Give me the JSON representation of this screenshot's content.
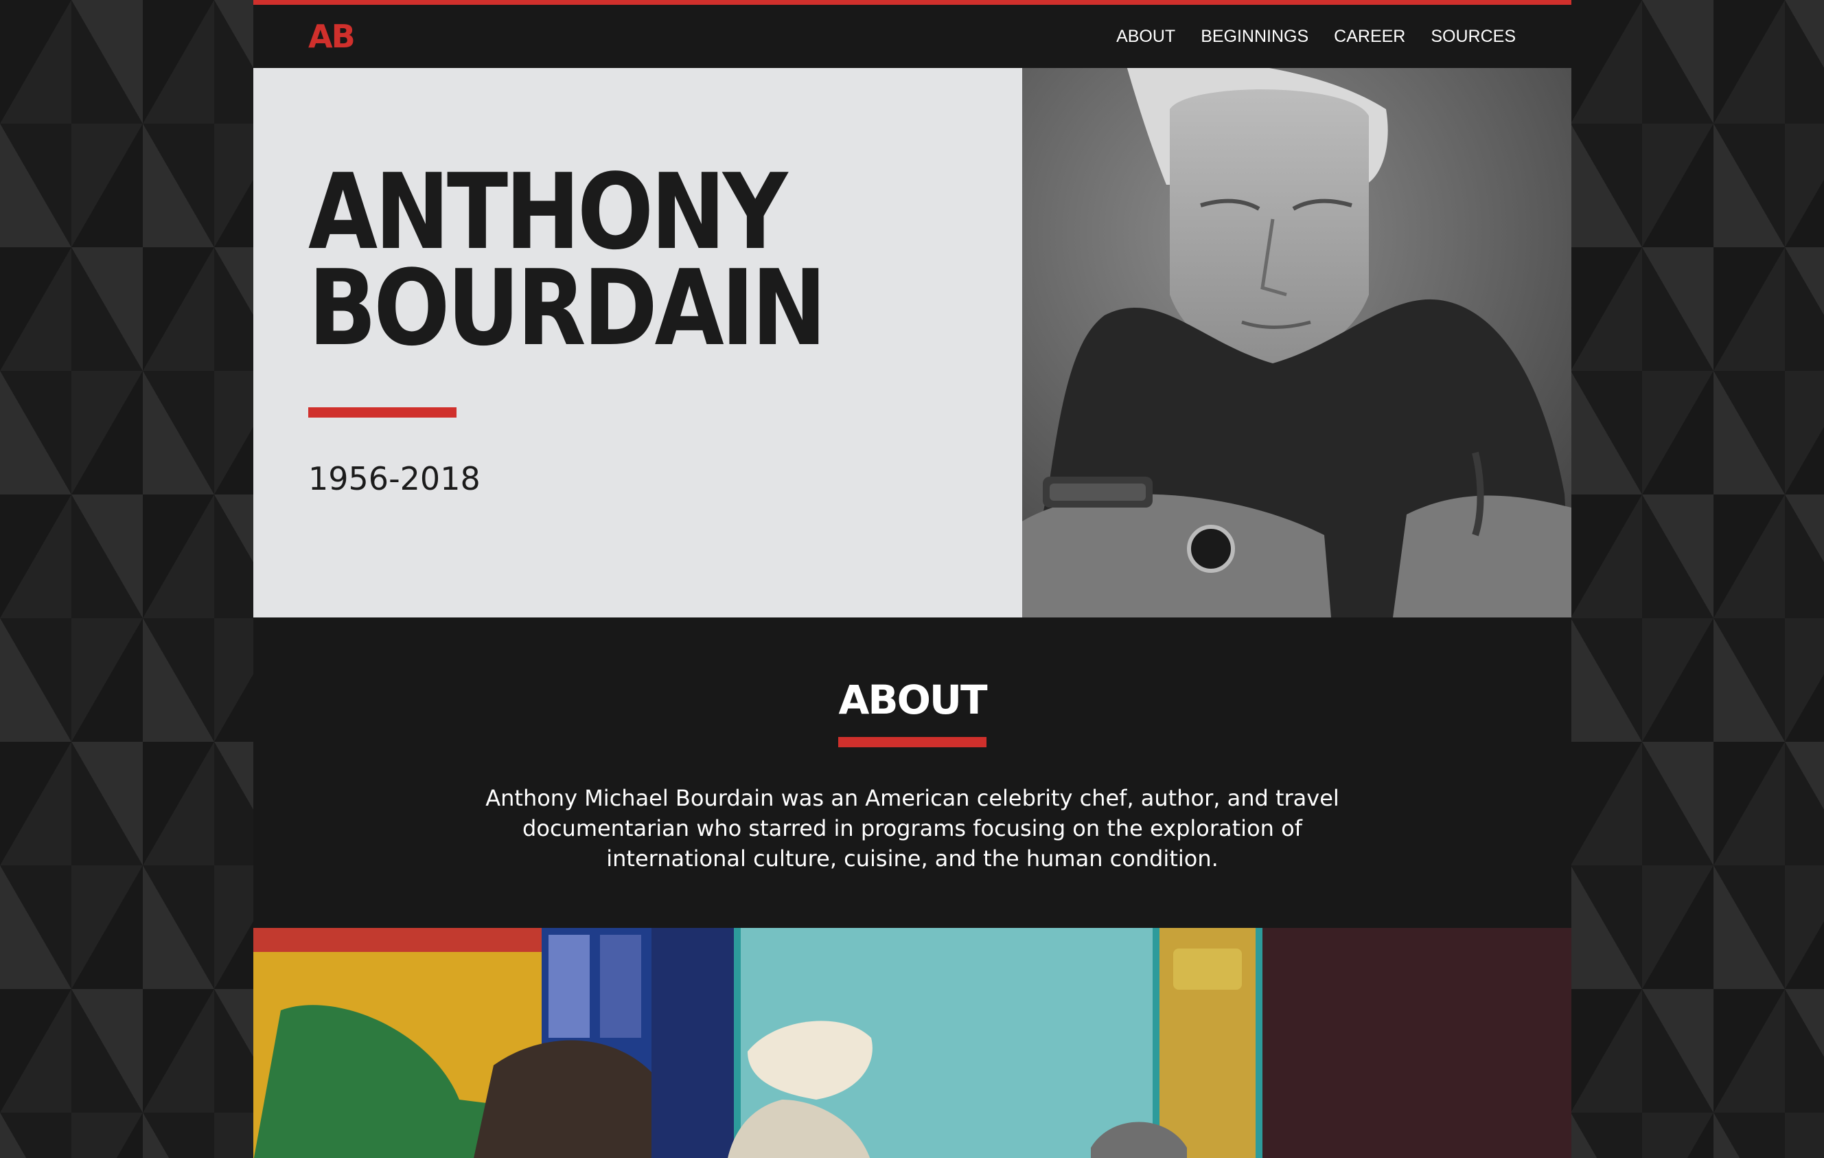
{
  "brand": {
    "logo": "AB",
    "accent": "#d0302c"
  },
  "nav": {
    "items": [
      {
        "label": "ABOUT"
      },
      {
        "label": "BEGINNINGS"
      },
      {
        "label": "CAREER"
      },
      {
        "label": "SOURCES"
      }
    ]
  },
  "hero": {
    "name_line1": "ANTHONY",
    "name_line2": "BOURDAIN",
    "years": "1956-2018",
    "portrait_icon": "portrait-photo"
  },
  "about": {
    "title": "ABOUT",
    "text": "Anthony Michael Bourdain was an American celebrity chef, author, and travel documentarian who starred in programs focusing on the exploration of international culture, cuisine, and the human condition."
  },
  "feature": {
    "photo_icon": "feature-photo"
  }
}
